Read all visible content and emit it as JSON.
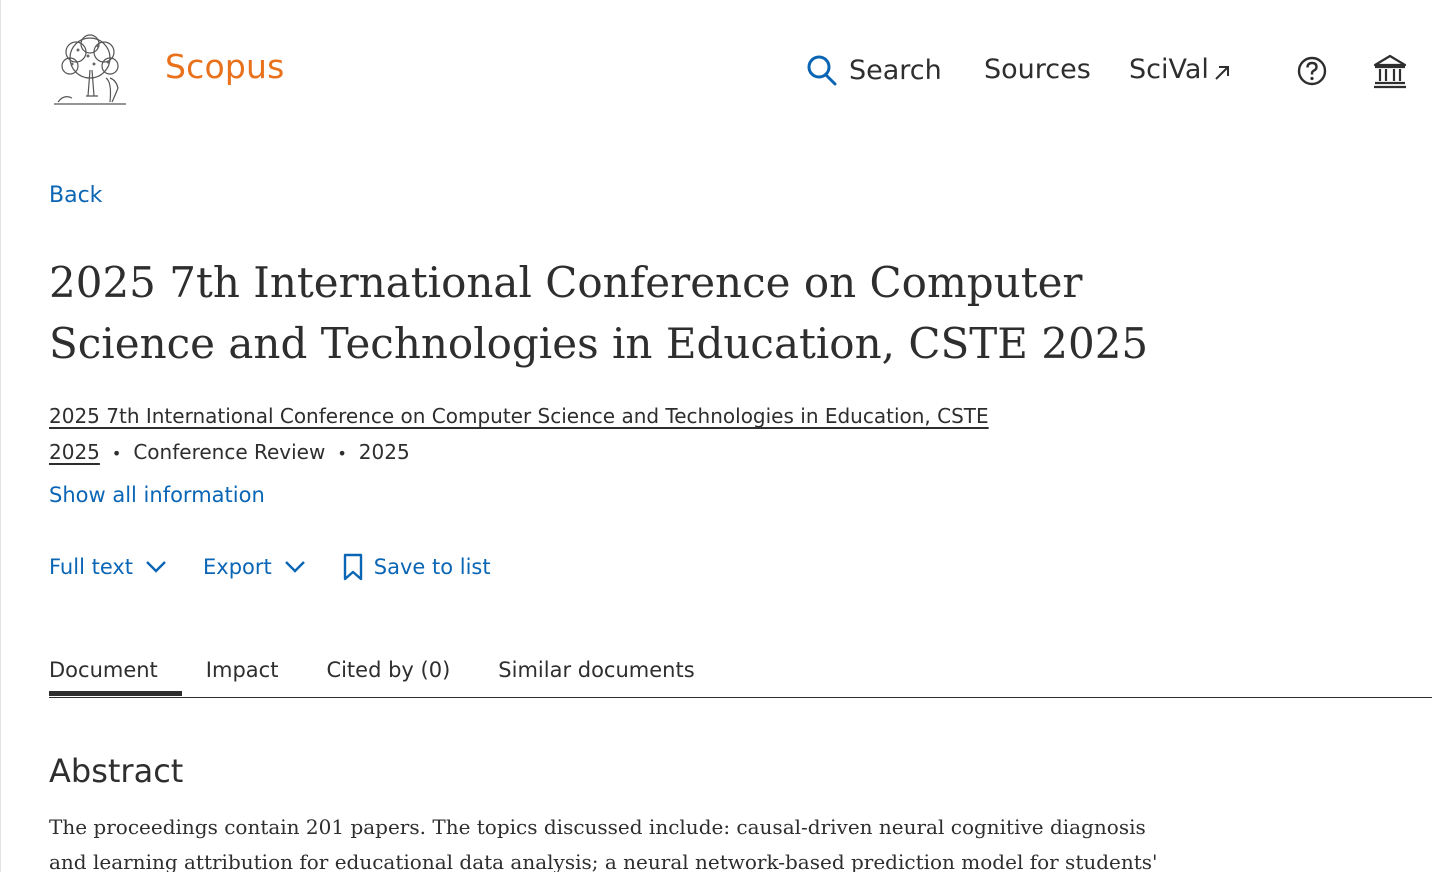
{
  "header": {
    "brand": "Scopus",
    "nav": {
      "search": "Search",
      "sources": "Sources",
      "scival": "SciVal"
    }
  },
  "back_label": "Back",
  "document": {
    "title": "2025 7th International Conference on Computer Science and Technologies in Education, CSTE 2025",
    "source_title": "2025 7th International Conference on Computer Science and Technologies in Education, CSTE 2025",
    "doc_type": "Conference Review",
    "year": "2025",
    "show_all_label": "Show all information"
  },
  "actions": {
    "full_text": "Full text",
    "export": "Export",
    "save_to_list": "Save to list"
  },
  "tabs": [
    {
      "label": "Document",
      "active": true
    },
    {
      "label": "Impact",
      "active": false
    },
    {
      "label": "Cited by (0)",
      "active": false
    },
    {
      "label": "Similar documents",
      "active": false
    }
  ],
  "abstract": {
    "heading": "Abstract",
    "text": "The proceedings contain 201 papers. The topics discussed include: causal-driven neural cognitive diagnosis and learning attribution for educational data analysis; a neural network-based prediction model for students'"
  },
  "colors": {
    "brand_orange": "#e9711c",
    "link_blue": "#0a66b5",
    "text": "#2e2e2e"
  }
}
